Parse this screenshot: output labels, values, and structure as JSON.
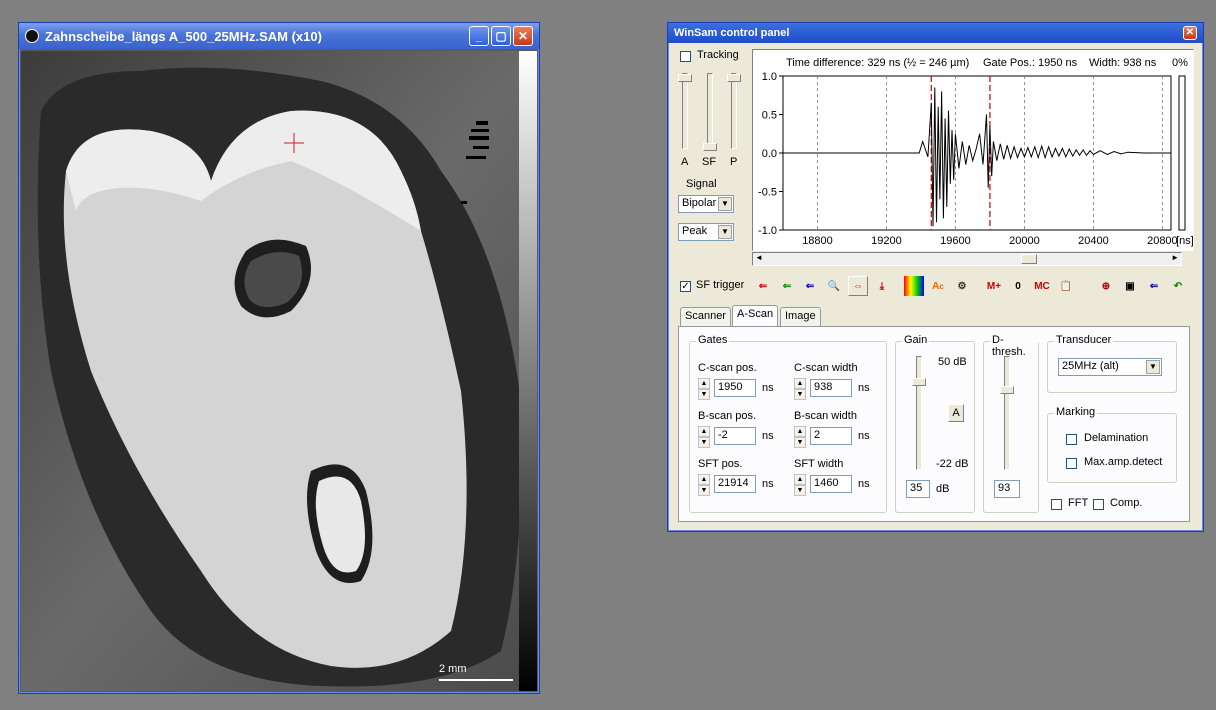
{
  "image_window": {
    "title": "Zahnscheibe_längs A_500_25MHz.SAM  (x10)",
    "scale_label": "2 mm"
  },
  "control_panel": {
    "title": "WinSam control panel",
    "tracking_label": "Tracking",
    "slider_labels": [
      "A",
      "SF",
      "P"
    ],
    "signal_label": "Signal",
    "signal_value": "Bipolar",
    "detect_value": "Peak",
    "sf_trigger_label": "SF trigger",
    "sf_trigger_checked": true,
    "tabs": [
      "Scanner",
      "A-Scan",
      "Image"
    ],
    "active_tab": "A-Scan",
    "toolbar": {
      "m_plus": "M+",
      "zero": "0",
      "mc": "MC"
    },
    "gates": {
      "label": "Gates",
      "cscan_pos_label": "C-scan pos.",
      "cscan_pos": "1950",
      "cscan_width_label": "C-scan width",
      "cscan_width": "938",
      "bscan_pos_label": "B-scan pos.",
      "bscan_pos": "-2",
      "bscan_width_label": "B-scan width",
      "bscan_width": "2",
      "sft_pos_label": "SFT pos.",
      "sft_pos": "21914",
      "sft_width_label": "SFT width",
      "sft_width": "1460",
      "unit": "ns"
    },
    "gain": {
      "label": "Gain",
      "max_label": "50 dB",
      "min_label": "-22 dB",
      "auto_button": "A",
      "value": "35",
      "unit": "dB"
    },
    "dthresh": {
      "label": "D-thresh.",
      "value": "93"
    },
    "transducer": {
      "label": "Transducer",
      "value": "25MHz (alt)"
    },
    "marking": {
      "label": "Marking",
      "delamination_label": "Delamination",
      "maxamp_label": "Max.amp.detect"
    },
    "fft_label": "FFT",
    "comp_label": "Comp.",
    "plot_header": {
      "time_diff": "Time difference: 329 ns (½ = 246 µm)",
      "gate_pos": "Gate Pos.: 1950 ns",
      "width": "Width: 938 ns",
      "percent": "0%"
    }
  },
  "chart_data": {
    "type": "line",
    "xlabel": "[ns]",
    "ylabel": "",
    "xlim": [
      18600,
      20850
    ],
    "ylim": [
      -1.0,
      1.0
    ],
    "x_ticks": [
      "18800",
      "19200",
      "19600",
      "20000",
      "20400",
      "20800"
    ],
    "y_ticks": [
      "1.0",
      "0.5",
      "0.0",
      "-0.5",
      "-1.0"
    ],
    "gate_markers_ns": [
      19460,
      19800
    ],
    "series": [
      {
        "x": [
          18600,
          19390,
          19410,
          19440,
          19460,
          19470,
          19480,
          19490,
          19500,
          19510,
          19520,
          19530,
          19540,
          19550,
          19560,
          19570,
          19580,
          19590,
          19600,
          19620,
          19640,
          19660,
          19680,
          19700,
          19720,
          19740,
          19760,
          19780,
          19790,
          19800,
          19810,
          19820,
          19840,
          19860,
          19880,
          19900,
          19920,
          19940,
          19960,
          19980,
          20000,
          20020,
          20040,
          20060,
          20080,
          20100,
          20120,
          20140,
          20160,
          20180,
          20200,
          20220,
          20240,
          20260,
          20280,
          20300,
          20320,
          20340,
          20360,
          20380,
          20400,
          20440,
          20480,
          20520,
          20560,
          20600,
          20700,
          20850
        ],
        "values": [
          0.0,
          0.0,
          0.15,
          -0.05,
          0.65,
          -0.95,
          0.85,
          -0.9,
          0.6,
          -0.6,
          0.8,
          -0.85,
          0.45,
          -0.7,
          0.55,
          -0.4,
          0.3,
          -0.35,
          0.25,
          -0.2,
          0.15,
          -0.15,
          0.1,
          -0.1,
          0.05,
          0.25,
          -0.15,
          0.5,
          -0.45,
          0.35,
          -0.3,
          0.15,
          -0.1,
          0.12,
          -0.08,
          0.1,
          -0.07,
          0.08,
          -0.06,
          0.06,
          -0.05,
          0.07,
          -0.05,
          0.08,
          -0.06,
          0.09,
          -0.06,
          0.08,
          -0.05,
          0.06,
          -0.04,
          0.06,
          -0.05,
          0.05,
          -0.04,
          0.04,
          -0.03,
          0.04,
          -0.03,
          0.03,
          -0.02,
          0.03,
          -0.02,
          0.02,
          -0.01,
          0.01,
          0.0,
          0.0
        ]
      }
    ]
  }
}
